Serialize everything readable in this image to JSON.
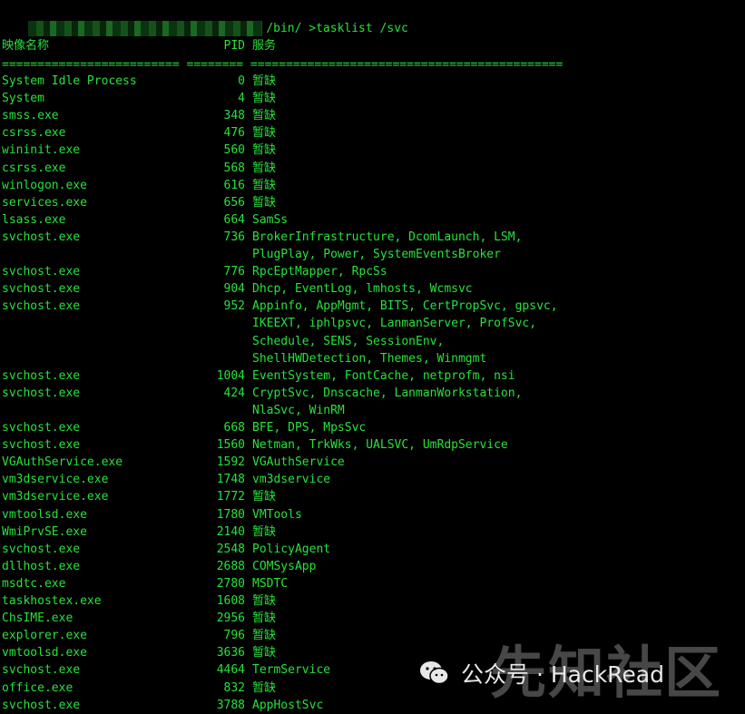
{
  "terminal": {
    "prompt": "/bin/ >tasklist /svc",
    "header": {
      "name": "映像名称",
      "pid": "PID",
      "services": "服务"
    },
    "separator": "========================= ======== ============================================",
    "rows": [
      {
        "name": "System Idle Process",
        "pid": "0",
        "services": [
          "暂缺"
        ]
      },
      {
        "name": "System",
        "pid": "4",
        "services": [
          "暂缺"
        ]
      },
      {
        "name": "smss.exe",
        "pid": "348",
        "services": [
          "暂缺"
        ]
      },
      {
        "name": "csrss.exe",
        "pid": "476",
        "services": [
          "暂缺"
        ]
      },
      {
        "name": "wininit.exe",
        "pid": "560",
        "services": [
          "暂缺"
        ]
      },
      {
        "name": "csrss.exe",
        "pid": "568",
        "services": [
          "暂缺"
        ]
      },
      {
        "name": "winlogon.exe",
        "pid": "616",
        "services": [
          "暂缺"
        ]
      },
      {
        "name": "services.exe",
        "pid": "656",
        "services": [
          "暂缺"
        ]
      },
      {
        "name": "lsass.exe",
        "pid": "664",
        "services": [
          "SamSs"
        ]
      },
      {
        "name": "svchost.exe",
        "pid": "736",
        "services": [
          "BrokerInfrastructure, DcomLaunch, LSM,",
          "PlugPlay, Power, SystemEventsBroker"
        ]
      },
      {
        "name": "svchost.exe",
        "pid": "776",
        "services": [
          "RpcEptMapper, RpcSs"
        ]
      },
      {
        "name": "svchost.exe",
        "pid": "904",
        "services": [
          "Dhcp, EventLog, lmhosts, Wcmsvc"
        ]
      },
      {
        "name": "svchost.exe",
        "pid": "952",
        "services": [
          "Appinfo, AppMgmt, BITS, CertPropSvc, gpsvc,",
          "IKEEXT, iphlpsvc, LanmanServer, ProfSvc,",
          "Schedule, SENS, SessionEnv,",
          "ShellHWDetection, Themes, Winmgmt"
        ]
      },
      {
        "name": "svchost.exe",
        "pid": "1004",
        "services": [
          "EventSystem, FontCache, netprofm, nsi"
        ]
      },
      {
        "name": "svchost.exe",
        "pid": "424",
        "services": [
          "CryptSvc, Dnscache, LanmanWorkstation,",
          "NlaSvc, WinRM"
        ]
      },
      {
        "name": "svchost.exe",
        "pid": "668",
        "services": [
          "BFE, DPS, MpsSvc"
        ]
      },
      {
        "name": "svchost.exe",
        "pid": "1560",
        "services": [
          "Netman, TrkWks, UALSVC, UmRdpService"
        ]
      },
      {
        "name": "VGAuthService.exe",
        "pid": "1592",
        "services": [
          "VGAuthService"
        ]
      },
      {
        "name": "vm3dservice.exe",
        "pid": "1748",
        "services": [
          "vm3dservice"
        ]
      },
      {
        "name": "vm3dservice.exe",
        "pid": "1772",
        "services": [
          "暂缺"
        ]
      },
      {
        "name": "vmtoolsd.exe",
        "pid": "1780",
        "services": [
          "VMTools"
        ]
      },
      {
        "name": "WmiPrvSE.exe",
        "pid": "2140",
        "services": [
          "暂缺"
        ]
      },
      {
        "name": "svchost.exe",
        "pid": "2548",
        "services": [
          "PolicyAgent"
        ]
      },
      {
        "name": "dllhost.exe",
        "pid": "2688",
        "services": [
          "COMSysApp"
        ]
      },
      {
        "name": "msdtc.exe",
        "pid": "2780",
        "services": [
          "MSDTC"
        ]
      },
      {
        "name": "taskhostex.exe",
        "pid": "1608",
        "services": [
          "暂缺"
        ]
      },
      {
        "name": "ChsIME.exe",
        "pid": "2956",
        "services": [
          "暂缺"
        ]
      },
      {
        "name": "explorer.exe",
        "pid": "796",
        "services": [
          "暂缺"
        ]
      },
      {
        "name": "vmtoolsd.exe",
        "pid": "3636",
        "services": [
          "暂缺"
        ]
      },
      {
        "name": "svchost.exe",
        "pid": "4464",
        "services": [
          "TermService"
        ]
      },
      {
        "name": "office.exe",
        "pid": "832",
        "services": [
          "暂缺"
        ]
      },
      {
        "name": "svchost.exe",
        "pid": "3788",
        "services": [
          "AppHostSvc"
        ]
      }
    ]
  },
  "watermark": {
    "text": "公众号 · HackRead",
    "icon": "wechat-icon"
  },
  "site_mark": "先知社区",
  "colors": {
    "background": "#000000",
    "text": "#27e23a",
    "watermark": "#e8e8e8"
  }
}
